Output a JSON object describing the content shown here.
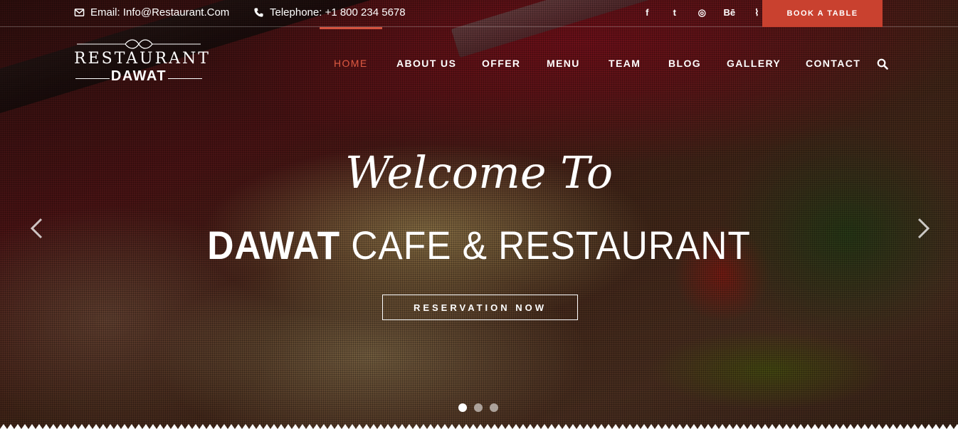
{
  "topbar": {
    "email": "Email: Info@Restaurant.Com",
    "telephone": "Telephone: +1 800 234 5678",
    "socials": [
      {
        "icon": "facebook-icon",
        "glyph": "f"
      },
      {
        "icon": "twitter-icon",
        "glyph": "t"
      },
      {
        "icon": "dribbble-icon",
        "glyph": "◎"
      },
      {
        "icon": "behance-icon",
        "glyph": "Bē"
      },
      {
        "icon": "rss-icon",
        "glyph": "⌇"
      }
    ],
    "book_label": "BOOK A TABLE"
  },
  "logo": {
    "top": "RESTAURANT",
    "bottom": "DAWAT"
  },
  "nav": {
    "items": [
      {
        "label": "HOME",
        "active": true
      },
      {
        "label": "ABOUT US",
        "active": false
      },
      {
        "label": "OFFER",
        "active": false
      },
      {
        "label": "MENU",
        "active": false
      },
      {
        "label": "TEAM",
        "active": false
      },
      {
        "label": "BLOG",
        "active": false
      },
      {
        "label": "GALLERY",
        "active": false
      },
      {
        "label": "CONTACT",
        "active": false
      }
    ]
  },
  "hero": {
    "welcome": "Welcome To",
    "headline_bold": "DAWAT",
    "headline_rest": " CAFE & RESTAURANT",
    "button": "RESERVATION NOW",
    "slides": 3,
    "active_slide": 1
  },
  "colors": {
    "accent": "#c9412f",
    "nav_active": "#de5a42"
  }
}
